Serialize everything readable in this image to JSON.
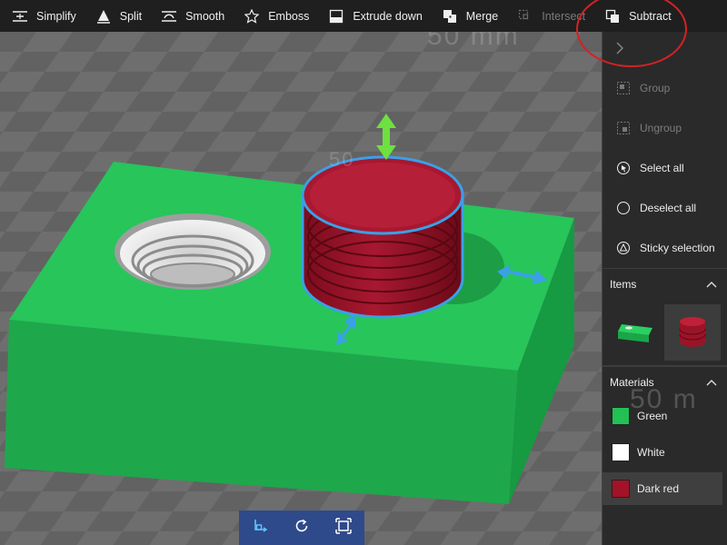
{
  "toolbar": {
    "items": [
      {
        "label": "Simplify",
        "icon": "simplify-icon",
        "enabled": true
      },
      {
        "label": "Split",
        "icon": "split-icon",
        "enabled": true
      },
      {
        "label": "Smooth",
        "icon": "smooth-icon",
        "enabled": true
      },
      {
        "label": "Emboss",
        "icon": "star-icon",
        "enabled": true
      },
      {
        "label": "Extrude down",
        "icon": "extrude-down-icon",
        "enabled": true
      },
      {
        "label": "Merge",
        "icon": "merge-icon",
        "enabled": true
      },
      {
        "label": "Intersect",
        "icon": "intersect-icon",
        "enabled": false
      },
      {
        "label": "Subtract",
        "icon": "subtract-icon",
        "enabled": true
      }
    ]
  },
  "viewport": {
    "watermarks": [
      "50 mm",
      "50",
      "50 m"
    ]
  },
  "panel": {
    "actions": [
      {
        "label": "Group",
        "icon": "group-icon",
        "enabled": false
      },
      {
        "label": "Ungroup",
        "icon": "ungroup-icon",
        "enabled": false
      },
      {
        "label": "Select all",
        "icon": "select-all-icon",
        "enabled": true
      },
      {
        "label": "Deselect all",
        "icon": "deselect-all-icon",
        "enabled": true
      },
      {
        "label": "Sticky selection",
        "icon": "sticky-selection-icon",
        "enabled": true
      }
    ],
    "items_header": "Items",
    "materials_header": "Materials",
    "materials": [
      {
        "label": "Green",
        "color": "#22c055",
        "selected": false
      },
      {
        "label": "White",
        "color": "#ffffff",
        "selected": false
      },
      {
        "label": "Dark red",
        "color": "#a31228",
        "selected": true
      }
    ]
  },
  "colors": {
    "green": "#22c055",
    "dark_red": "#a31228",
    "selection_blue": "#3aa0e8",
    "gizmo_green": "#6ee040"
  }
}
